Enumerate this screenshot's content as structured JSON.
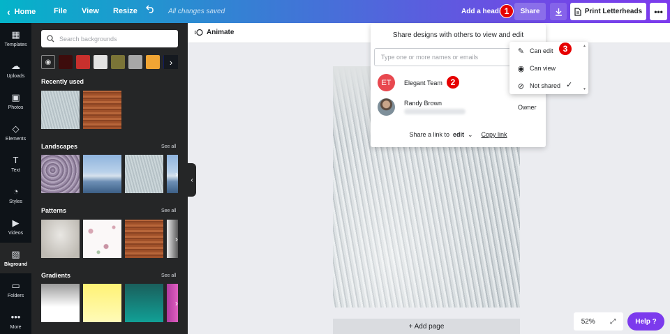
{
  "topbar": {
    "home": "Home",
    "file": "File",
    "view": "View",
    "resize": "Resize",
    "save_status": "All changes saved",
    "add_heading": "Add a heading",
    "share": "Share",
    "print": "Print Letterheads",
    "more": "•••",
    "gradient_start": "#04b4c9",
    "gradient_end": "#7c3aed"
  },
  "badges": {
    "one": "1",
    "two": "2",
    "three": "3"
  },
  "leftnav": {
    "items": [
      {
        "label": "Templates",
        "icon": "templates-icon"
      },
      {
        "label": "Uploads",
        "icon": "upload-cloud-icon"
      },
      {
        "label": "Photos",
        "icon": "photos-icon"
      },
      {
        "label": "Elements",
        "icon": "elements-icon"
      },
      {
        "label": "Text",
        "icon": "text-icon"
      },
      {
        "label": "Styles",
        "icon": "styles-icon"
      },
      {
        "label": "Videos",
        "icon": "videos-icon"
      },
      {
        "label": "Bkground",
        "icon": "background-icon",
        "active": true
      },
      {
        "label": "Folders",
        "icon": "folder-icon"
      },
      {
        "label": "More",
        "icon": "more-dots-icon"
      }
    ]
  },
  "panel": {
    "search_placeholder": "Search backgrounds",
    "swatch_colors": [
      "#3d0c0c",
      "#c8302d",
      "#e2e2e2",
      "#7b7437",
      "#a7a7a7",
      "#f1a534",
      "#0f1a5e"
    ],
    "recently_used": "Recently used",
    "landscapes": "Landscapes",
    "patterns": "Patterns",
    "gradients": "Gradients",
    "see_all": "See all"
  },
  "canvas": {
    "animate": "Animate",
    "add_page": "+ Add page",
    "zoom": "52%",
    "help": "Help ?"
  },
  "share_popover": {
    "title": "Share designs with others to view and edit",
    "input_placeholder": "Type one or more names or emails",
    "team_initials": "ET",
    "team_name": "Elegant Team",
    "user_name": "Randy Brown",
    "owner": "Owner",
    "share_link_prefix": "Share a link to",
    "share_link_mode": "edit",
    "copy_link": "Copy link"
  },
  "permissions": {
    "can_edit": "Can edit",
    "can_view": "Can view",
    "not_shared": "Not shared"
  }
}
